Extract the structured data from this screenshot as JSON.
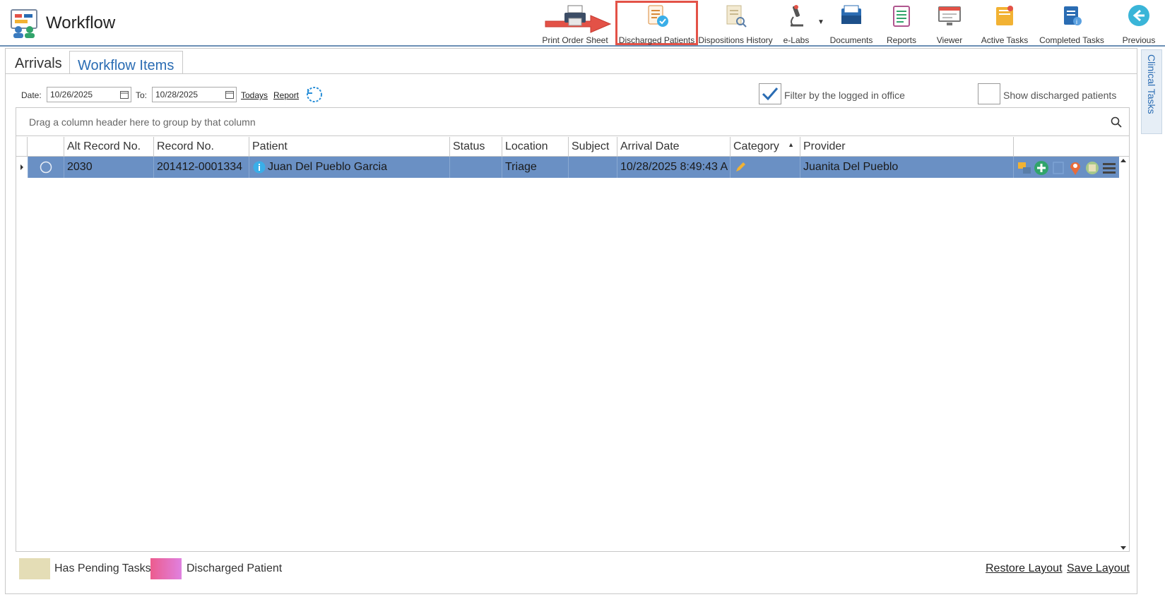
{
  "app": {
    "title": "Workflow"
  },
  "toolbar": {
    "print_order_sheet": "Print Order Sheet",
    "discharged_patients": "Discharged Patients",
    "dispositions_history": "Dispositions History",
    "e_labs": "e-Labs",
    "documents": "Documents",
    "reports": "Reports",
    "viewer": "Viewer",
    "active_tasks": "Active Tasks",
    "completed_tasks": "Completed Tasks",
    "previous": "Previous"
  },
  "tabs": {
    "arrivals": "Arrivals",
    "workflow_items": "Workflow Items"
  },
  "side_panel": {
    "clinical_tasks": "Clinical Tasks"
  },
  "filters": {
    "date_label": "Date:",
    "date_from": "10/26/2025",
    "to_label": "To:",
    "date_to": "10/28/2025",
    "todays_link": "Todays",
    "report_link": "Report",
    "filter_office_label": "Filter by the logged in office",
    "filter_office_checked": true,
    "show_discharged_label": "Show discharged patients",
    "show_discharged_checked": false
  },
  "grid": {
    "group_hint": "Drag a column header here to group by that column",
    "columns": {
      "alt_record": "Alt Record No.",
      "record": "Record No.",
      "patient": "Patient",
      "status": "Status",
      "location": "Location",
      "subject": "Subject",
      "arrival_date": "Arrival Date",
      "category": "Category",
      "provider": "Provider"
    },
    "sort_column": "Category",
    "row": {
      "alt_record": "2030",
      "record": "201412-0001334",
      "patient": "Juan Del Pueblo Garcia",
      "status": "",
      "location": "Triage",
      "subject": "",
      "arrival_date": "10/28/2025 8:49:43 A",
      "category": "",
      "provider": "Juanita Del Pueblo"
    },
    "row_action_icons": [
      "merge-icon",
      "add-icon",
      "blank-icon",
      "location-pin-icon",
      "notes-icon",
      "menu-icon"
    ]
  },
  "legend": {
    "pending_tasks": "Has Pending Tasks",
    "pending_color": "#e4ddb6",
    "discharged": "Discharged Patient",
    "discharged_color": "#e86ab0"
  },
  "footer": {
    "restore_layout": "Restore Layout",
    "save_layout": "Save Layout"
  },
  "colors": {
    "accent": "#2a6cb3",
    "selected_row": "#6a90c4",
    "highlight_box": "#e35247"
  }
}
